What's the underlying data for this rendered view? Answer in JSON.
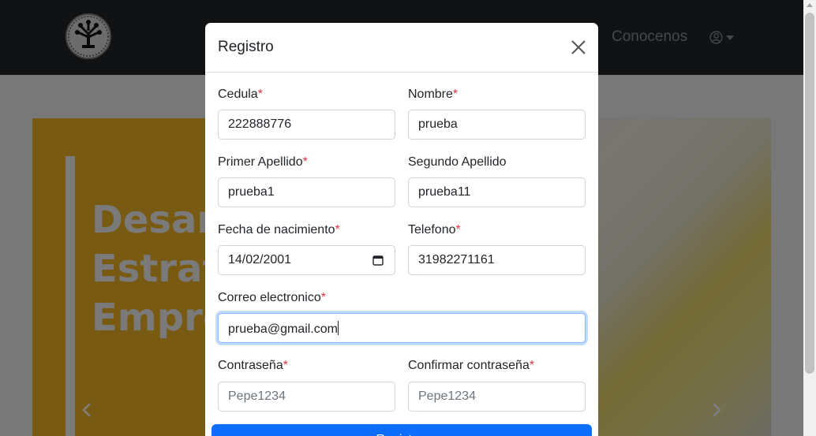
{
  "navbar": {
    "link_about": "Conocenos"
  },
  "hero": {
    "lines": [
      "Desar",
      "Estrat",
      "Empre"
    ]
  },
  "modal": {
    "title": "Registro",
    "fields": {
      "cedula": {
        "label": "Cedula",
        "value": "222888776"
      },
      "nombre": {
        "label": "Nombre",
        "value": "prueba"
      },
      "primer_apellido": {
        "label": "Primer Apellido",
        "value": "prueba1"
      },
      "segundo_apellido": {
        "label": "Segundo Apellido",
        "value": "prueba11"
      },
      "fecha_nacimiento": {
        "label": "Fecha de nacimiento",
        "value": "14/02/2001"
      },
      "telefono": {
        "label": "Telefono",
        "value": "31982271161"
      },
      "correo": {
        "label": "Correo electronico",
        "value": "prueba@gmail.com"
      },
      "contrasena": {
        "label": "Contraseña",
        "placeholder": "Pepe1234"
      },
      "confirmar_contrasena": {
        "label": "Confirmar contraseña",
        "placeholder": "Pepe1234"
      }
    },
    "required_mark": "*",
    "submit_label": "Registrar"
  },
  "colors": {
    "navbar_bg": "#212529",
    "primary": "#0d6efd",
    "required": "#dc3545",
    "hero_yellow": "#f2b426"
  },
  "icons": [
    "logo-tree-icon",
    "user-circle-icon",
    "caret-down-icon",
    "close-icon",
    "calendar-icon",
    "chevron-left-icon",
    "chevron-right-icon"
  ]
}
